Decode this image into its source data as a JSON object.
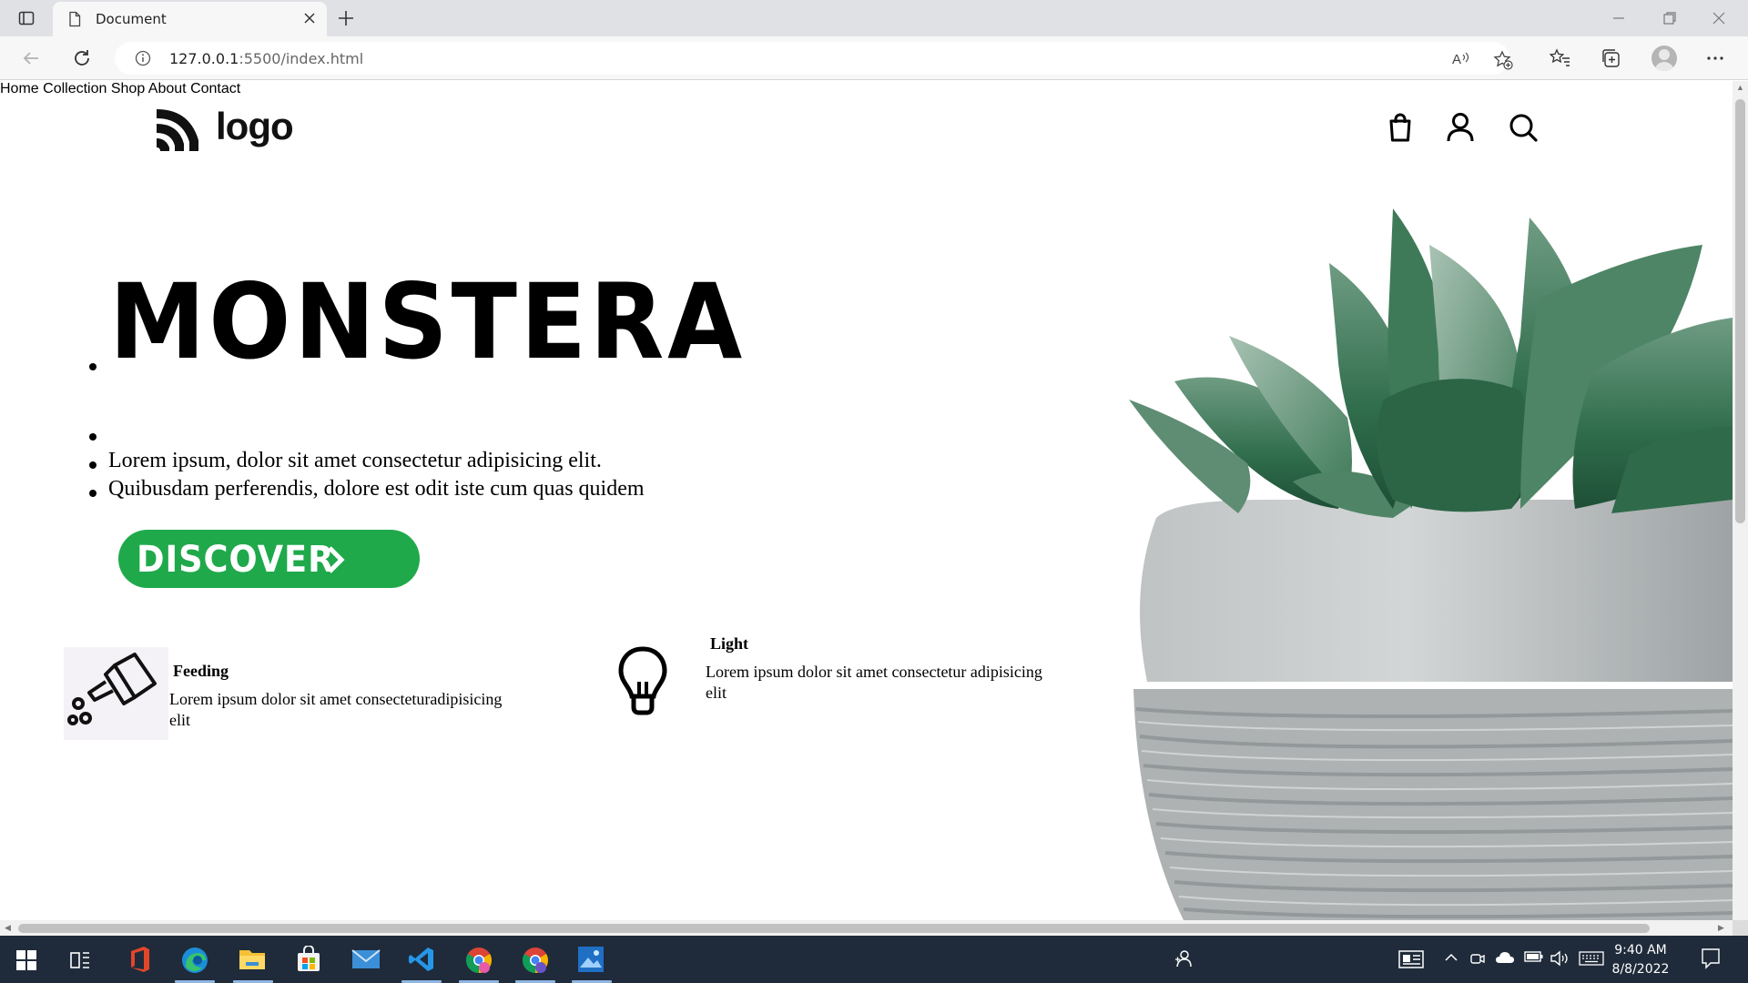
{
  "browser": {
    "tab_title": "Document",
    "url_host": "127.0.0.1",
    "url_path": ":5500/index.html"
  },
  "site": {
    "logo_text": "logo",
    "nav": [
      "Home",
      "Collection",
      "Shop",
      "About",
      "Contact"
    ],
    "hero": {
      "title": "MONSTERA",
      "lines": [
        "Lorem ipsum, dolor sit amet consectetur adipisicing elit.",
        "Quibusdam perferendis, dolore est odit iste cum quas quidem"
      ],
      "cta_label": "DISCOVER"
    },
    "features": [
      {
        "title": "Feeding",
        "text_line1": "Lorem ipsum dolor sit amet consecteturadipisicing",
        "text_line2": "elit",
        "icon": "watering-can-icon"
      },
      {
        "title": "Light",
        "text_line1": "Lorem ipsum dolor sit amet consectetur adipisicing",
        "text_line2": "elit",
        "icon": "lightbulb-icon"
      }
    ],
    "colors": {
      "accent": "#1fa94b",
      "text": "#000000"
    }
  },
  "taskbar": {
    "time": "9:40 AM",
    "date": "8/8/2022",
    "apps": [
      "start-icon",
      "task-view-icon",
      "office-icon",
      "edge-icon",
      "file-explorer-icon",
      "store-icon",
      "mail-icon",
      "vscode-icon",
      "chrome-icon",
      "chrome-profile-icon",
      "photos-icon"
    ]
  }
}
